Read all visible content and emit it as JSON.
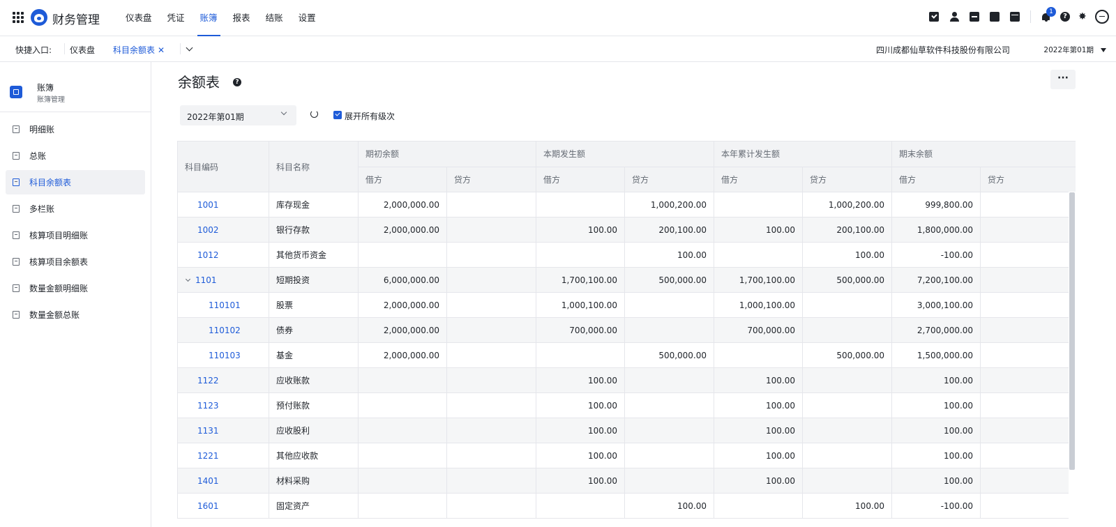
{
  "app": {
    "title": "财务管理"
  },
  "topnav": [
    {
      "label": "仪表盘",
      "active": false
    },
    {
      "label": "凭证",
      "active": false
    },
    {
      "label": "账簿",
      "active": true
    },
    {
      "label": "报表",
      "active": false
    },
    {
      "label": "结账",
      "active": false
    },
    {
      "label": "设置",
      "active": false
    }
  ],
  "top_icons": [
    "calendar-check-icon",
    "user-icon",
    "document-icon",
    "phone-icon",
    "calendar-icon",
    "bell-icon",
    "help-icon",
    "gear-icon",
    "avatar-icon"
  ],
  "notifications": {
    "badge": "1"
  },
  "quickbar": {
    "label": "快捷入口:",
    "tabs": [
      {
        "label": "仪表盘"
      },
      {
        "label": "科目余额表",
        "close": "✕"
      }
    ],
    "company": "四川成都仙草软件科技股份有限公司",
    "period": "2022年第01期"
  },
  "sidebar": {
    "title": "账簿",
    "subtitle": "账簿管理",
    "items": [
      {
        "label": "明细账"
      },
      {
        "label": "总账"
      },
      {
        "label": "科目余额表",
        "active": true
      },
      {
        "label": "多栏账"
      },
      {
        "label": "核算项目明细账"
      },
      {
        "label": "核算项目余额表"
      },
      {
        "label": "数量金额明细账"
      },
      {
        "label": "数量金额总账"
      }
    ]
  },
  "page": {
    "title": "余额表",
    "more": "···",
    "period_filter": "2022年第01期",
    "expand_label": "展开所有级次"
  },
  "table": {
    "headers": {
      "code": "科目编码",
      "name": "科目名称",
      "groups": [
        "期初余额",
        "本期发生额",
        "本年累计发生额",
        "期末余额"
      ],
      "debit": "借方",
      "credit": "贷方"
    },
    "rows": [
      {
        "code": "1001",
        "name": "库存现金",
        "v": [
          "2,000,000.00",
          "",
          "",
          "1,000,200.00",
          "",
          "1,000,200.00",
          "999,800.00",
          ""
        ]
      },
      {
        "code": "1002",
        "name": "银行存款",
        "v": [
          "2,000,000.00",
          "",
          "100.00",
          "200,100.00",
          "100.00",
          "200,100.00",
          "1,800,000.00",
          ""
        ]
      },
      {
        "code": "1012",
        "name": "其他货币资金",
        "v": [
          "",
          "",
          "",
          "100.00",
          "",
          "100.00",
          "-100.00",
          ""
        ]
      },
      {
        "code": "1101",
        "name": "短期投资",
        "expanded": true,
        "v": [
          "6,000,000.00",
          "",
          "1,700,100.00",
          "500,000.00",
          "1,700,100.00",
          "500,000.00",
          "7,200,100.00",
          ""
        ]
      },
      {
        "code": "110101",
        "name": "股票",
        "child": true,
        "v": [
          "2,000,000.00",
          "",
          "1,000,100.00",
          "",
          "1,000,100.00",
          "",
          "3,000,100.00",
          ""
        ]
      },
      {
        "code": "110102",
        "name": "债券",
        "child": true,
        "v": [
          "2,000,000.00",
          "",
          "700,000.00",
          "",
          "700,000.00",
          "",
          "2,700,000.00",
          ""
        ]
      },
      {
        "code": "110103",
        "name": "基金",
        "child": true,
        "v": [
          "2,000,000.00",
          "",
          "",
          "500,000.00",
          "",
          "500,000.00",
          "1,500,000.00",
          ""
        ]
      },
      {
        "code": "1122",
        "name": "应收账款",
        "v": [
          "",
          "",
          "100.00",
          "",
          "100.00",
          "",
          "100.00",
          ""
        ]
      },
      {
        "code": "1123",
        "name": "预付账款",
        "v": [
          "",
          "",
          "100.00",
          "",
          "100.00",
          "",
          "100.00",
          ""
        ]
      },
      {
        "code": "1131",
        "name": "应收股利",
        "v": [
          "",
          "",
          "100.00",
          "",
          "100.00",
          "",
          "100.00",
          ""
        ]
      },
      {
        "code": "1221",
        "name": "其他应收款",
        "v": [
          "",
          "",
          "100.00",
          "",
          "100.00",
          "",
          "100.00",
          ""
        ]
      },
      {
        "code": "1401",
        "name": "材料采购",
        "v": [
          "",
          "",
          "100.00",
          "",
          "100.00",
          "",
          "100.00",
          ""
        ]
      },
      {
        "code": "1601",
        "name": "固定资产",
        "v": [
          "",
          "",
          "",
          "100.00",
          "",
          "100.00",
          "-100.00",
          ""
        ]
      }
    ]
  },
  "colors": {
    "accent": "#1e5bd8",
    "text": "#1f2329",
    "muted": "#646a73",
    "header_bg": "#f2f3f5",
    "border": "#e5e6eb"
  }
}
